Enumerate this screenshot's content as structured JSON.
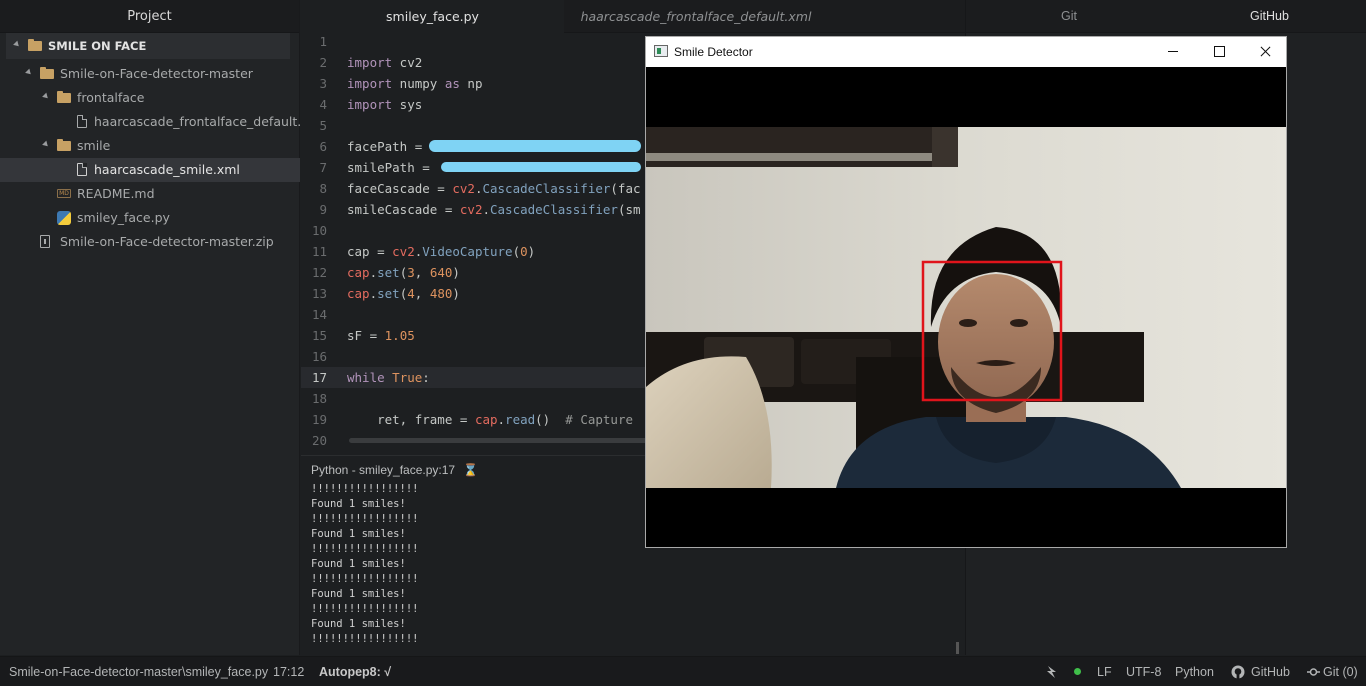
{
  "tree": {
    "header": "Project",
    "root": "SMILE ON FACE",
    "items": [
      {
        "label": "Smile-on-Face-detector-master"
      },
      {
        "label": "frontalface"
      },
      {
        "label": "haarcascade_frontalface_default.xml"
      },
      {
        "label": "smile"
      },
      {
        "label": "haarcascade_smile.xml"
      },
      {
        "label": "README.md"
      },
      {
        "label": "smiley_face.py"
      },
      {
        "label": "Smile-on-Face-detector-master.zip"
      }
    ],
    "md_badge": "MD"
  },
  "editor": {
    "tabs": [
      {
        "label": "smiley_face.py"
      },
      {
        "label": "haarcascade_frontalface_default.xml"
      }
    ],
    "line_numbers": [
      "1",
      "2",
      "3",
      "4",
      "5",
      "6",
      "7",
      "8",
      "9",
      "10",
      "11",
      "12",
      "13",
      "14",
      "15",
      "16",
      "17",
      "18",
      "19",
      "20"
    ],
    "code": {
      "l2": {
        "kw": "import",
        "rest": " cv2"
      },
      "l3": {
        "kw": "import",
        "mid": " numpy ",
        "kw2": "as",
        "rest": " np"
      },
      "l4": {
        "kw": "import",
        "rest": " sys"
      },
      "l6": {
        "a": "facePath = "
      },
      "l7": {
        "a": "smilePath = "
      },
      "l8": {
        "a": "faceCascade = ",
        "mod": "cv2",
        "dot": ".",
        "fn": "CascadeClassifier",
        "rest": "(fac"
      },
      "l9": {
        "a": "smileCascade = ",
        "mod": "cv2",
        "dot": ".",
        "fn": "CascadeClassifier",
        "rest": "(sm"
      },
      "l11": {
        "a": "cap = ",
        "mod": "cv2",
        "dot": ".",
        "fn": "VideoCapture",
        "p1": "(",
        "n": "0",
        "p2": ")"
      },
      "l12": {
        "obj": "cap",
        "dot": ".",
        "fn": "set",
        "p1": "(",
        "n1": "3",
        "c": ", ",
        "n2": "640",
        "p2": ")"
      },
      "l13": {
        "obj": "cap",
        "dot": ".",
        "fn": "set",
        "p1": "(",
        "n1": "4",
        "c": ", ",
        "n2": "480",
        "p2": ")"
      },
      "l15": {
        "a": "sF = ",
        "n": "1.05"
      },
      "l17": {
        "kw": "while",
        "sp": " ",
        "b": "True",
        "rest": ":"
      },
      "l19": {
        "a": "    ret, frame = ",
        "obj": "cap",
        "dot": ".",
        "fn": "read",
        "p": "()",
        "cm": "  # Capture"
      }
    }
  },
  "console": {
    "title": "Python - smiley_face.py:17",
    "hourglass": "⌛",
    "lines": [
      "!!!!!!!!!!!!!!!!!",
      "Found 1 smiles!",
      "!!!!!!!!!!!!!!!!!",
      "Found 1 smiles!",
      "!!!!!!!!!!!!!!!!!",
      "Found 1 smiles!",
      "!!!!!!!!!!!!!!!!!",
      "Found 1 smiles!",
      "!!!!!!!!!!!!!!!!!",
      "Found 1 smiles!",
      "!!!!!!!!!!!!!!!!!"
    ]
  },
  "right_panel": {
    "tabs": [
      {
        "label": "Git"
      },
      {
        "label": "GitHub"
      }
    ]
  },
  "window": {
    "title": "Smile Detector",
    "buttons": {
      "minimize": "minimize",
      "maximize": "maximize",
      "close": "close"
    },
    "icon": "window-icon"
  },
  "status": {
    "path": "Smile-on-Face-detector-master\\smiley_face.py",
    "cursor": "17:12",
    "autopep8": "Autopep8: √",
    "encoding_eol": "LF",
    "encoding": "UTF-8",
    "grammar": "Python",
    "github": "GitHub",
    "git": "Git (0)"
  },
  "colors": {
    "background": "#1d1f21",
    "keyword": "#b294bb",
    "number": "#de935f",
    "class": "#e36b5f",
    "function": "#81a2be",
    "folder": "#c7a164",
    "face_box": "#e0141b",
    "status_dot": "#3fbf4a"
  }
}
